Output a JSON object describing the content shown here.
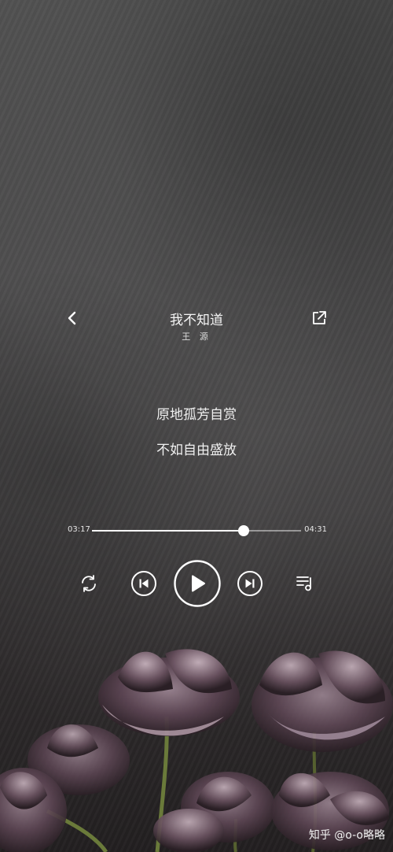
{
  "song": {
    "title": "我不知道",
    "artist": "王 源"
  },
  "lyrics": {
    "lines": [
      "原地孤芳自赏",
      "不如自由盛放"
    ]
  },
  "player": {
    "current_time": "03:17",
    "duration": "04:31",
    "progress": 0.727,
    "state": "paused"
  },
  "icons": {
    "back": "chevron-left-icon",
    "share": "share-external-icon",
    "repeat": "repeat-icon",
    "previous": "skip-previous-icon",
    "play": "play-icon",
    "next": "skip-next-icon",
    "playlist": "playlist-icon"
  },
  "watermark": {
    "text": "知乎 @o-o略略"
  }
}
